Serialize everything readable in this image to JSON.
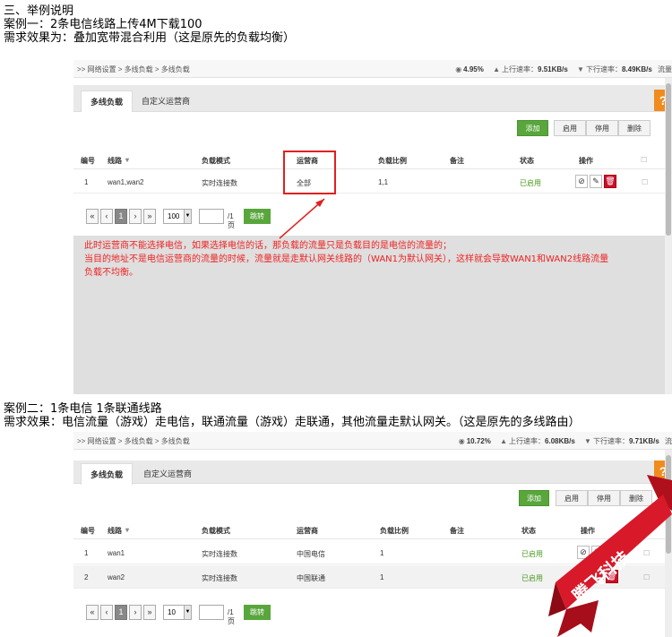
{
  "heading": {
    "section": "三、举例说明",
    "case1_title": "案例一：2条电信线路上传4M下载100",
    "case1_req": "需求效果为：叠加宽带混合利用（这是原先的负载均衡）",
    "case2_title": "案例二：1条电信 1条联通线路",
    "case2_req": "需求效果：电信流量（游戏）走电信，联通流量（游戏）走联通，其他流量走默认网关。（这是原先的多线路由）"
  },
  "shot1": {
    "breadcrumb": ">> 网络设置 > 多线负载 > 多线负载",
    "cpu": "4.95%",
    "up_label": "上行速率：",
    "up_value": "9.51KB/s",
    "down_label": "下行速率：",
    "down_value": "8.49KB/s",
    "tail": "流量",
    "tabs": [
      "多线负载",
      "自定义运营商"
    ],
    "help": "?",
    "buttons": {
      "add": "添加",
      "enable": "启用",
      "disable": "停用",
      "delete": "删除"
    },
    "columns": [
      "编号",
      "线路",
      "负载模式",
      "运营商",
      "负载比例",
      "备注",
      "状态",
      "操作"
    ],
    "rows": [
      {
        "id": "1",
        "line": "wan1,wan2",
        "mode": "实时连接数",
        "isp": "全部",
        "ratio": "1,1",
        "remark": "",
        "status": "已启用"
      }
    ],
    "pager": {
      "first": "«",
      "prev": "‹",
      "page": "1",
      "next": "›",
      "last": "»",
      "per_page": "100",
      "page_total": "/1页",
      "go": "跳转"
    },
    "note_lines": [
      "此时运营商不能选择电信，如果选择电信的话，那负载的流量只是负载目的是电信的流量的；",
      "当目的地址不是电信运营商的流量的时候，流量就是走默认网关线路的（WAN1为默认网关），这样就会导致WAN1和WAN2线路流量",
      "负载不均衡。"
    ]
  },
  "shot2": {
    "breadcrumb": ">> 网络设置 > 多线负载 > 多线负载",
    "cpu": "10.72%",
    "up_label": "上行速率：",
    "up_value": "6.08KB/s",
    "down_label": "下行速率：",
    "down_value": "9.71KB/s",
    "tail": "流",
    "tabs": [
      "多线负载",
      "自定义运营商"
    ],
    "help": "?",
    "buttons": {
      "add": "添加",
      "enable": "启用",
      "disable": "停用",
      "delete": "删除"
    },
    "columns": [
      "编号",
      "线路",
      "负载模式",
      "运营商",
      "负载比例",
      "备注",
      "状态",
      "操作"
    ],
    "rows": [
      {
        "id": "1",
        "line": "wan1",
        "mode": "实时连接数",
        "isp": "中国电信",
        "ratio": "1",
        "remark": "",
        "status": "已启用"
      },
      {
        "id": "2",
        "line": "wan2",
        "mode": "实时连接数",
        "isp": "中国联通",
        "ratio": "1",
        "remark": "",
        "status": "已启用"
      }
    ],
    "pager": {
      "first": "«",
      "prev": "‹",
      "page": "1",
      "next": "›",
      "last": "»",
      "per_page": "10",
      "page_total": "/1页",
      "go": "跳转"
    }
  },
  "watermark": {
    "text": "腾飞科技"
  },
  "colors": {
    "accent_green": "#58a63c",
    "help_orange": "#f08c1e",
    "note_red": "#e22222",
    "delete_red": "#c8102e"
  },
  "icons": [
    "cpu-icon",
    "upload-icon",
    "download-icon",
    "sort-icon",
    "ban-icon",
    "edit-icon",
    "trash-icon",
    "checkbox-icon"
  ]
}
